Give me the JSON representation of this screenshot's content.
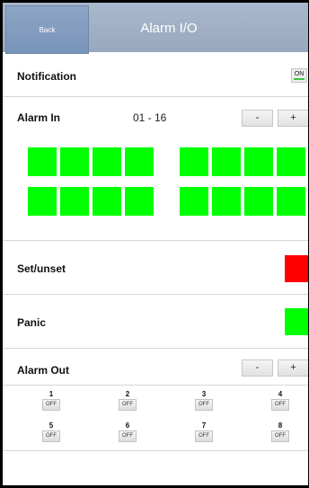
{
  "header": {
    "back_label": "Back",
    "title": "Alarm I/O"
  },
  "notification": {
    "label": "Notification",
    "toggle": "ON",
    "toggle_on_color": "#3cc63c"
  },
  "alarm_in": {
    "label": "Alarm In",
    "range": "01 - 16",
    "minus": "-",
    "plus": "+",
    "state_color": "#00ff00",
    "inputs": [
      "on",
      "on",
      "on",
      "on",
      "on",
      "on",
      "on",
      "on",
      "on",
      "on",
      "on",
      "on",
      "on",
      "on",
      "on",
      "on"
    ]
  },
  "set_unset": {
    "label": "Set/unset",
    "color": "#ff0000"
  },
  "panic": {
    "label": "Panic",
    "color": "#00ff00"
  },
  "alarm_out": {
    "label": "Alarm Out",
    "minus": "-",
    "plus": "+",
    "outputs": [
      {
        "num": "1",
        "state": "OFF"
      },
      {
        "num": "2",
        "state": "OFF"
      },
      {
        "num": "3",
        "state": "OFF"
      },
      {
        "num": "4",
        "state": "OFF"
      },
      {
        "num": "5",
        "state": "OFF"
      },
      {
        "num": "6",
        "state": "OFF"
      },
      {
        "num": "7",
        "state": "OFF"
      },
      {
        "num": "8",
        "state": "OFF"
      }
    ]
  }
}
